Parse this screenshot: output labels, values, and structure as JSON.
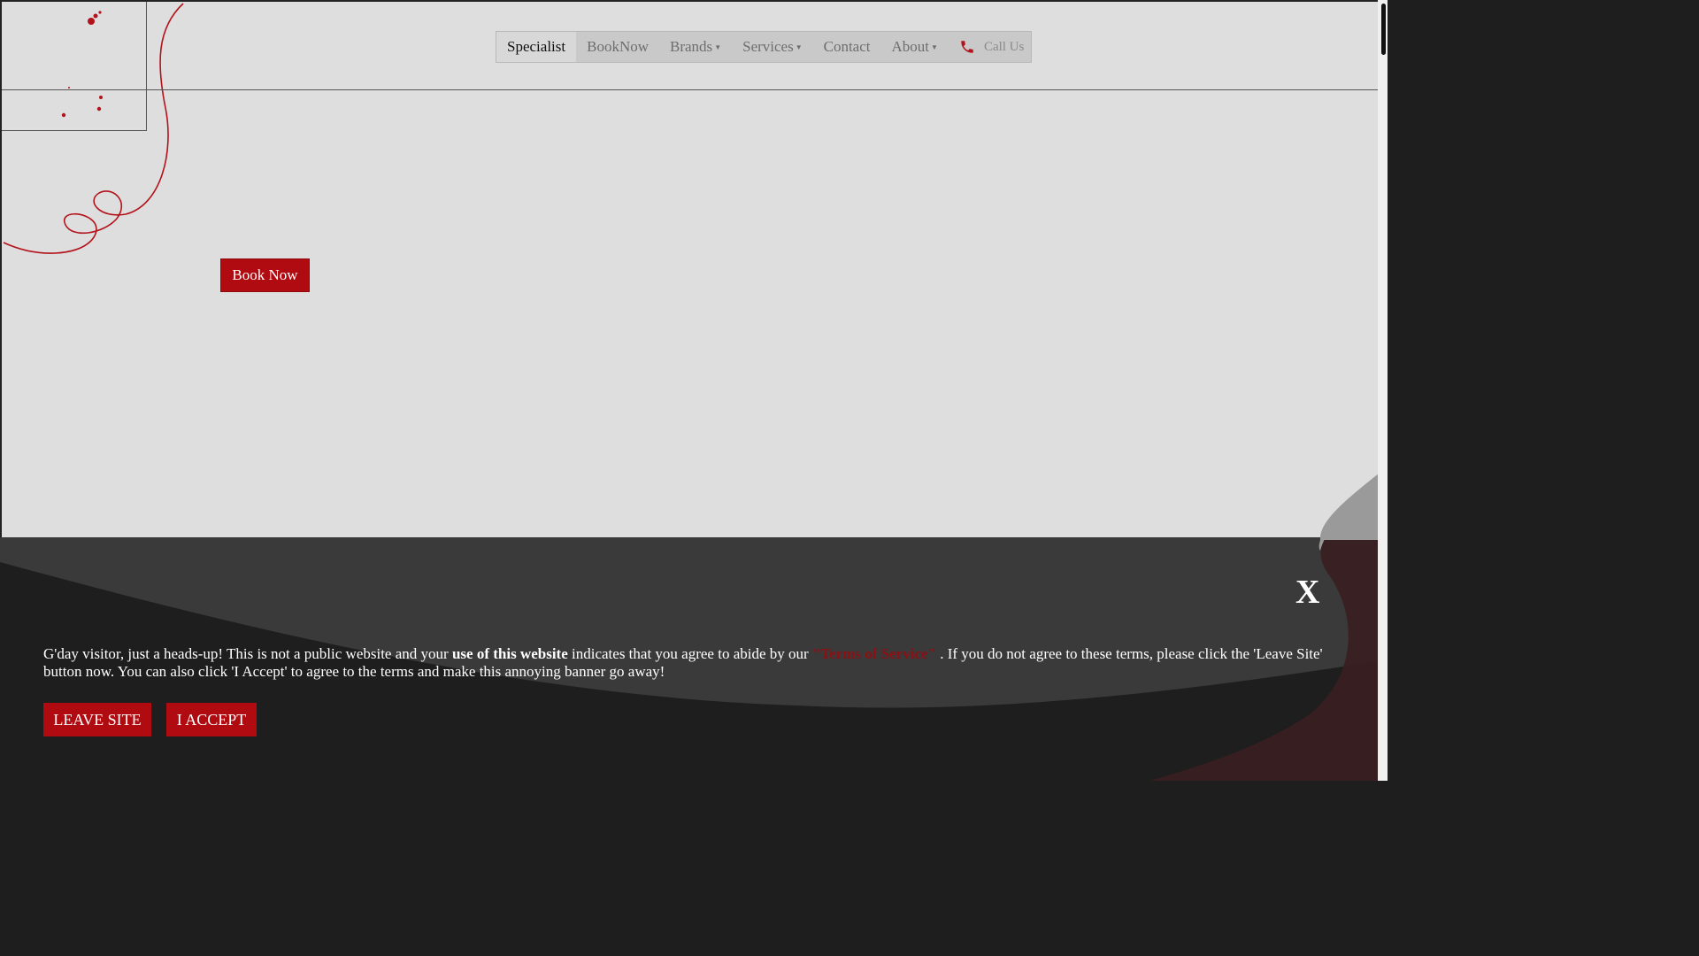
{
  "nav": {
    "items": [
      {
        "label": "Specialist",
        "active": true,
        "dropdown": false
      },
      {
        "label": "BookNow",
        "active": false,
        "dropdown": false
      },
      {
        "label": "Brands",
        "active": false,
        "dropdown": true
      },
      {
        "label": "Services",
        "active": false,
        "dropdown": true
      },
      {
        "label": "Contact",
        "active": false,
        "dropdown": false
      },
      {
        "label": "About",
        "active": false,
        "dropdown": true
      }
    ],
    "call_label": "Call Us",
    "call_icon": "phone-icon"
  },
  "hero": {
    "book_button_label": "Book Now"
  },
  "banner": {
    "close_label": "X",
    "text_part1": "G'day visitor, just a heads-up! This is not a public website and your ",
    "text_bold": "use of this website",
    "text_part2": " indicates that you agree to abide by our ",
    "tos_link_label": "\"Terms of Service\"",
    "text_part3": ". If you do not agree to these terms, please click the 'Leave Site' button now. You can also click 'I Accept' to agree to the terms and make this annoying banner go away!",
    "leave_button_label": "LEAVE SITE",
    "accept_button_label": "I ACCEPT"
  },
  "colors": {
    "accent_red": "#b00b10",
    "page_bg": "#dedede",
    "banner_bg": "#1e1e1e"
  }
}
